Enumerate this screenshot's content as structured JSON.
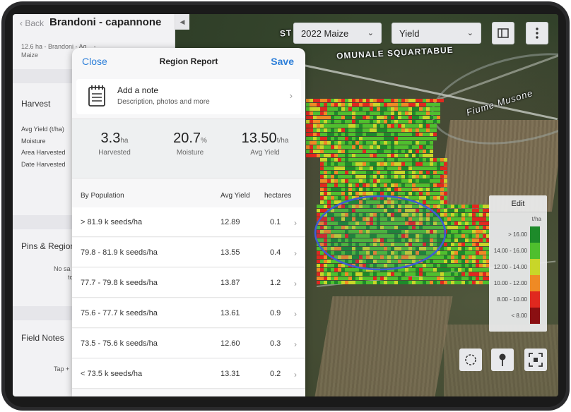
{
  "sidebar": {
    "back_label": "Back",
    "title": "Brandoni - capannone",
    "subtitle": "12.6 ha - Brandoni - Ag... - Maize",
    "harvest_heading": "Harvest",
    "harvest_rows": [
      "Avg Yield (t/ha)",
      "Moisture",
      "Area Harvested",
      "Date Harvested"
    ],
    "pins_heading": "Pins & Region",
    "pins_note": "No sa",
    "pins_note2": "to",
    "field_notes_heading": "Field Notes",
    "field_notes_note": "Tap +"
  },
  "toolbar": {
    "season_value": "2022 Maize",
    "layer_value": "Yield"
  },
  "map": {
    "label_road_a": "ST",
    "label_road_b": "OMUNALE SQUARTABUE",
    "label_river": "Fiume Musone"
  },
  "legend": {
    "edit_label": "Edit",
    "unit": "t/ha",
    "ranges": [
      {
        "label": "> 16.00",
        "color": "#1d8a2a"
      },
      {
        "label": "14.00 - 16.00",
        "color": "#4fbf2e"
      },
      {
        "label": "12.00 - 14.00",
        "color": "#c8d629"
      },
      {
        "label": "10.00 - 12.00",
        "color": "#ef8a24"
      },
      {
        "label": "8.00 - 10.00",
        "color": "#e0281f"
      },
      {
        "label": "< 8.00",
        "color": "#8a0f12"
      }
    ]
  },
  "modal": {
    "close_label": "Close",
    "title": "Region Report",
    "save_label": "Save",
    "note_title": "Add a note",
    "note_desc": "Description, photos and more",
    "stats": [
      {
        "value": "3.3",
        "unit": "ha",
        "label": "Harvested"
      },
      {
        "value": "20.7",
        "unit": "%",
        "label": "Moisture"
      },
      {
        "value": "13.50",
        "unit": "t/ha",
        "label": "Avg Yield"
      }
    ],
    "table": {
      "columns": [
        "By Population",
        "Avg Yield",
        "hectares"
      ],
      "rows": [
        {
          "population": "> 81.9 k seeds/ha",
          "avg_yield": "12.89",
          "hectares": "0.1"
        },
        {
          "population": "79.8 - 81.9 k seeds/ha",
          "avg_yield": "13.55",
          "hectares": "0.4"
        },
        {
          "population": "77.7 - 79.8 k seeds/ha",
          "avg_yield": "13.87",
          "hectares": "1.2"
        },
        {
          "population": "75.6 - 77.7 k seeds/ha",
          "avg_yield": "13.61",
          "hectares": "0.9"
        },
        {
          "population": "73.5 - 75.6 k seeds/ha",
          "avg_yield": "12.60",
          "hectares": "0.3"
        },
        {
          "population": "< 73.5 k seeds/ha",
          "avg_yield": "13.31",
          "hectares": "0.2"
        }
      ]
    }
  }
}
